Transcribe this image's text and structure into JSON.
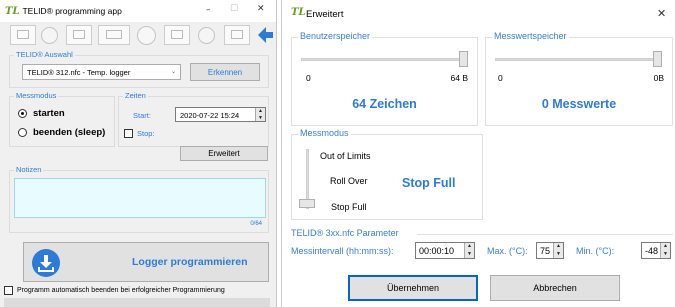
{
  "left_window": {
    "title": "TELID® programming app",
    "logo": "TL",
    "controls": {
      "minimize": "–",
      "maximize": "☐",
      "close": "✕"
    },
    "auswahl": {
      "group_label": "TELID® Auswahl",
      "selected": "TELID® 312.nfc - Temp. logger",
      "erkennen": "Erkennen"
    },
    "messmodus": {
      "group_label": "Messmodus",
      "starten": "starten",
      "beenden": "beenden (sleep)"
    },
    "zeiten": {
      "group_label": "Zeiten",
      "start_label": "Start:",
      "start_value": "2020-07-22 15:24",
      "stop_label": "Stop:"
    },
    "erweitert_button": "Erweitert",
    "notizen": {
      "group_label": "Notizen",
      "counter": "0/64"
    },
    "logger_button": "Logger programmieren",
    "auto_exit_label": "Programm automatisch beenden bei erfolgreicher Programmierung"
  },
  "right_window": {
    "title": "Erweitert",
    "logo": "TL",
    "close": "✕",
    "benutzerspeicher": {
      "group_label": "Benutzerspeicher",
      "min": "0",
      "max": "64 B",
      "value_text": "64 Zeichen",
      "level": 1.0
    },
    "messwertspeicher": {
      "group_label": "Messwertspeicher",
      "min": "0",
      "max": "0B",
      "value_text": "0 Messwerte",
      "level": 1.0
    },
    "messmodus": {
      "group_label": "Messmodus",
      "options": [
        "Out of Limits",
        "Roll Over",
        "Stop Full"
      ],
      "selected_text": "Stop Full"
    },
    "parameter": {
      "group_label": "TELID® 3xx.nfc Parameter",
      "intervall_label": "Messintervall (hh:mm:ss):",
      "intervall_value": "00:00:10",
      "max_label": "Max. (°C):",
      "max_value": "75",
      "min_label": "Min. (°C):",
      "min_value": "-48"
    },
    "uebernehmen": "Übernehmen",
    "abbrechen": "Abbrechen"
  },
  "colors": {
    "accent_blue": "#2e7bd6",
    "logo_green": "#6a9a1f",
    "textbox_bg": "#e8fbff"
  }
}
